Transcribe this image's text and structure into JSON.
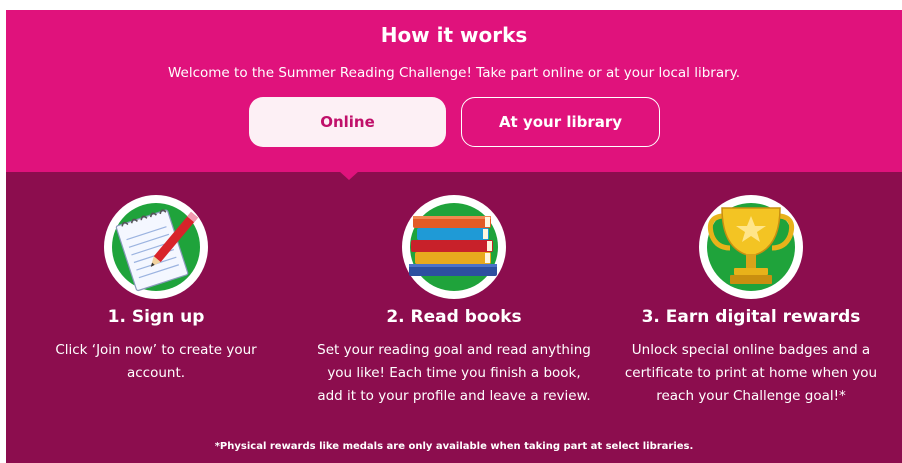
{
  "header": {
    "title": "How it works",
    "subtitle": "Welcome to the Summer Reading Challenge! Take part online or at your local library."
  },
  "tabs": [
    {
      "label": "Online",
      "selected": true
    },
    {
      "label": "At your library",
      "selected": false
    }
  ],
  "steps": [
    {
      "title": "1. Sign up",
      "text": "Click ‘Join now’ to create your account.",
      "icon": "notepad-pencil-icon"
    },
    {
      "title": "2. Read books",
      "text": "Set your reading goal and read anything you like! Each time you finish a book, add it to your profile and leave a review.",
      "icon": "book-stack-icon"
    },
    {
      "title": "3. Earn digital rewards",
      "text": "Unlock special online badges and a certificate to print at home when you reach your Challenge goal!*",
      "icon": "trophy-icon"
    }
  ],
  "footnote": "*Physical rewards like medals are only available when taking part at select libraries.",
  "colors": {
    "header_bg": "#e0127c",
    "body_bg": "#8c0d4e",
    "selected_tab_bg": "#fdf0f5",
    "selected_tab_text": "#c0106a",
    "circle_green": "#1fa33b"
  }
}
